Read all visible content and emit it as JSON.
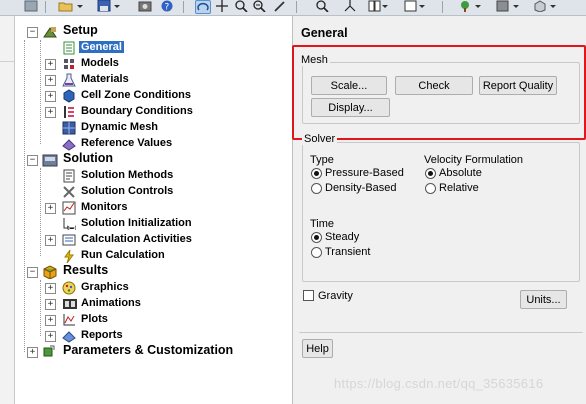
{
  "tree": {
    "setup": {
      "label": "Setup",
      "items": [
        {
          "label": "General",
          "icon": "general-icon",
          "selected": true
        },
        {
          "label": "Models",
          "icon": "models-icon"
        },
        {
          "label": "Materials",
          "icon": "materials-icon"
        },
        {
          "label": "Cell Zone Conditions",
          "icon": "cell-zone-icon"
        },
        {
          "label": "Boundary Conditions",
          "icon": "boundary-icon"
        },
        {
          "label": "Dynamic Mesh",
          "icon": "dynamic-mesh-icon"
        },
        {
          "label": "Reference Values",
          "icon": "reference-values-icon"
        }
      ]
    },
    "solution": {
      "label": "Solution",
      "items": [
        {
          "label": "Solution Methods",
          "icon": "solution-methods-icon"
        },
        {
          "label": "Solution Controls",
          "icon": "solution-controls-icon"
        },
        {
          "label": "Monitors",
          "icon": "monitors-icon"
        },
        {
          "label": "Solution Initialization",
          "icon": "initialization-icon"
        },
        {
          "label": "Calculation Activities",
          "icon": "calc-activities-icon"
        },
        {
          "label": "Run Calculation",
          "icon": "run-calculation-icon"
        }
      ]
    },
    "results": {
      "label": "Results",
      "items": [
        {
          "label": "Graphics",
          "icon": "graphics-icon"
        },
        {
          "label": "Animations",
          "icon": "animations-icon"
        },
        {
          "label": "Plots",
          "icon": "plots-icon"
        },
        {
          "label": "Reports",
          "icon": "reports-icon"
        }
      ]
    },
    "parameters": {
      "label": "Parameters & Customization"
    }
  },
  "panel": {
    "title": "General",
    "mesh": {
      "title": "Mesh",
      "scale": "Scale...",
      "check": "Check",
      "report_quality": "Report Quality",
      "display": "Display..."
    },
    "solver": {
      "title": "Solver",
      "type_label": "Type",
      "type_options": [
        "Pressure-Based",
        "Density-Based"
      ],
      "type_selected": "Pressure-Based",
      "velocity_label": "Velocity Formulation",
      "velocity_options": [
        "Absolute",
        "Relative"
      ],
      "velocity_selected": "Absolute",
      "time_label": "Time",
      "time_options": [
        "Steady",
        "Transient"
      ],
      "time_selected": "Steady"
    },
    "gravity": {
      "label": "Gravity",
      "checked": false
    },
    "units": "Units...",
    "help": "Help"
  },
  "watermark": "https://blog.csdn.net/qq_35635616",
  "colors": {
    "highlight": "#e0161c",
    "selection": "#2f6fc3"
  }
}
